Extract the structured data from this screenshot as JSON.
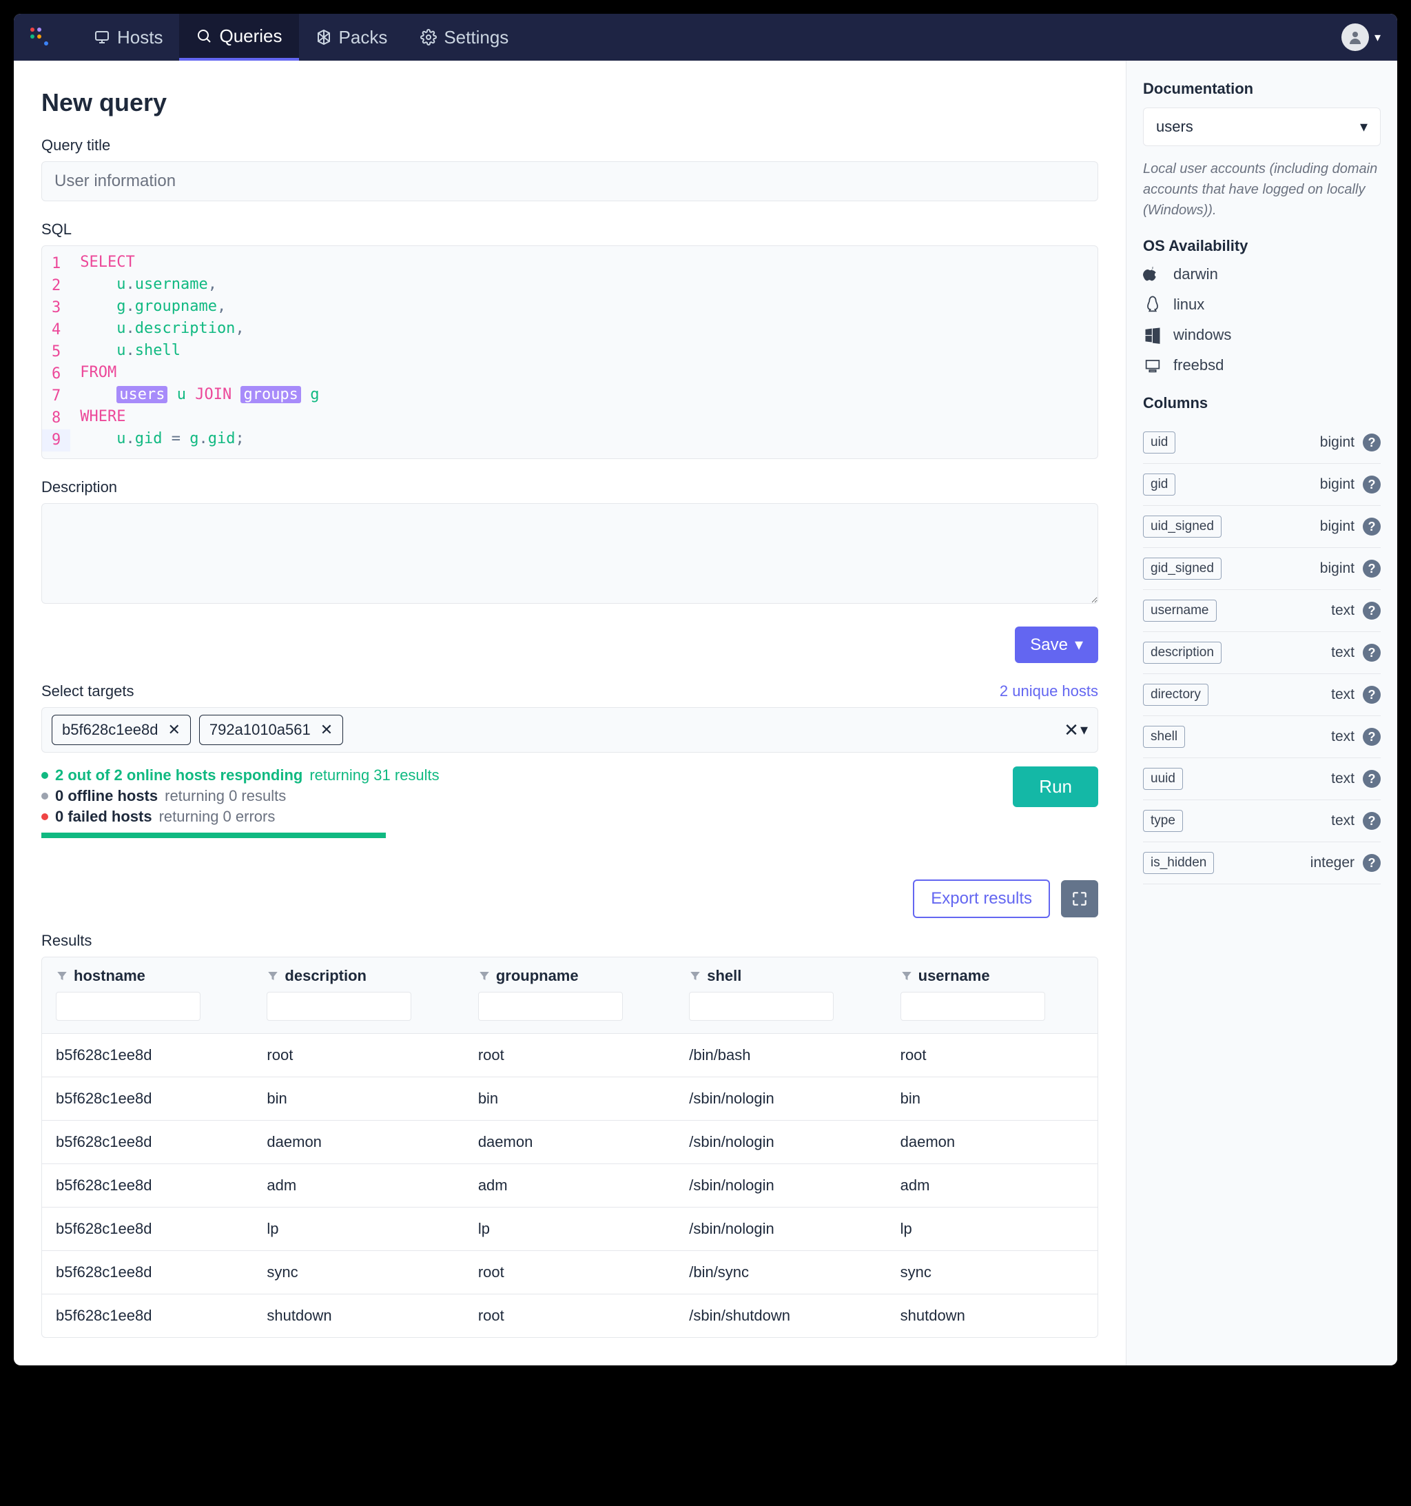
{
  "nav": {
    "hosts": "Hosts",
    "queries": "Queries",
    "packs": "Packs",
    "settings": "Settings"
  },
  "page_title": "New query",
  "query_title_label": "Query title",
  "query_title_value": "User information",
  "sql_label": "SQL",
  "sql_lines": [
    "SELECT",
    "    u.username,",
    "    g.groupname,",
    "    u.description,",
    "    u.shell",
    "FROM",
    "    users u JOIN groups g",
    "WHERE",
    "    u.gid = g.gid;"
  ],
  "description_label": "Description",
  "save_label": "Save",
  "targets_label": "Select targets",
  "targets_count": "2 unique hosts",
  "targets": [
    "b5f628c1ee8d",
    "792a1010a561"
  ],
  "status": {
    "online_bold": "2 out of 2 online hosts responding",
    "online_muted": "returning 31 results",
    "offline_bold": "0 offline hosts",
    "offline_muted": "returning 0 results",
    "failed_bold": "0 failed hosts",
    "failed_muted": "returning 0 errors"
  },
  "run_label": "Run",
  "export_label": "Export results",
  "results_label": "Results",
  "columns": [
    "hostname",
    "description",
    "groupname",
    "shell",
    "username"
  ],
  "rows": [
    {
      "hostname": "b5f628c1ee8d",
      "description": "root",
      "groupname": "root",
      "shell": "/bin/bash",
      "username": "root"
    },
    {
      "hostname": "b5f628c1ee8d",
      "description": "bin",
      "groupname": "bin",
      "shell": "/sbin/nologin",
      "username": "bin"
    },
    {
      "hostname": "b5f628c1ee8d",
      "description": "daemon",
      "groupname": "daemon",
      "shell": "/sbin/nologin",
      "username": "daemon"
    },
    {
      "hostname": "b5f628c1ee8d",
      "description": "adm",
      "groupname": "adm",
      "shell": "/sbin/nologin",
      "username": "adm"
    },
    {
      "hostname": "b5f628c1ee8d",
      "description": "lp",
      "groupname": "lp",
      "shell": "/sbin/nologin",
      "username": "lp"
    },
    {
      "hostname": "b5f628c1ee8d",
      "description": "sync",
      "groupname": "root",
      "shell": "/bin/sync",
      "username": "sync"
    },
    {
      "hostname": "b5f628c1ee8d",
      "description": "shutdown",
      "groupname": "root",
      "shell": "/sbin/shutdown",
      "username": "shutdown"
    }
  ],
  "sidebar": {
    "doc_title": "Documentation",
    "dropdown_value": "users",
    "description": "Local user accounts (including domain accounts that have logged on locally (Windows)).",
    "os_title": "OS Availability",
    "os": [
      "darwin",
      "linux",
      "windows",
      "freebsd"
    ],
    "columns_title": "Columns",
    "columns": [
      {
        "name": "uid",
        "type": "bigint"
      },
      {
        "name": "gid",
        "type": "bigint"
      },
      {
        "name": "uid_signed",
        "type": "bigint"
      },
      {
        "name": "gid_signed",
        "type": "bigint"
      },
      {
        "name": "username",
        "type": "text"
      },
      {
        "name": "description",
        "type": "text"
      },
      {
        "name": "directory",
        "type": "text"
      },
      {
        "name": "shell",
        "type": "text"
      },
      {
        "name": "uuid",
        "type": "text"
      },
      {
        "name": "type",
        "type": "text"
      },
      {
        "name": "is_hidden",
        "type": "integer"
      }
    ]
  }
}
